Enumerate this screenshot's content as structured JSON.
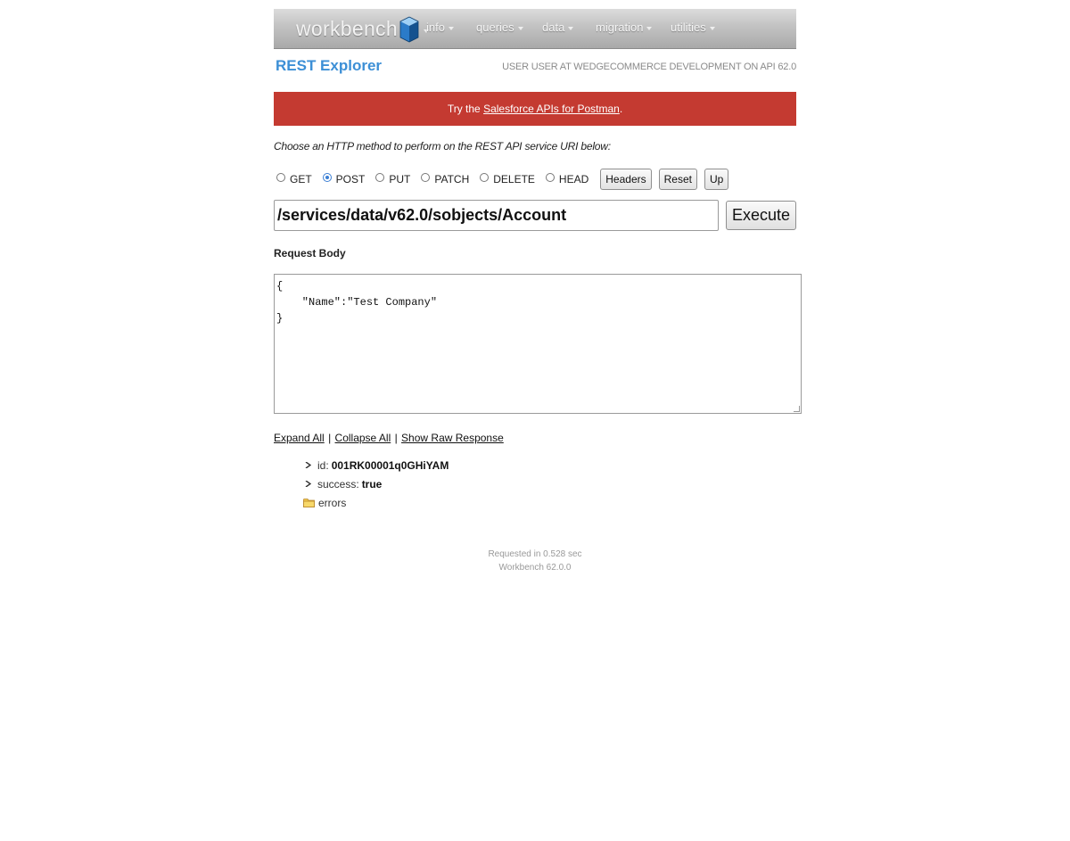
{
  "nav": {
    "logo": "workbench",
    "menu": [
      "info",
      "queries",
      "data",
      "migration",
      "utilities"
    ]
  },
  "header": {
    "title": "REST Explorer",
    "user_info": "USER USER AT WEDGECOMMERCE DEVELOPMENT ON API 62.0"
  },
  "banner": {
    "prefix": "Try the",
    "link": "Salesforce APIs for Postman",
    "suffix": "."
  },
  "form": {
    "instructions": "Choose an HTTP method to perform on the REST API service URI below:",
    "methods": [
      {
        "label": "GET",
        "checked": false
      },
      {
        "label": "POST",
        "checked": true
      },
      {
        "label": "PUT",
        "checked": false
      },
      {
        "label": "PATCH",
        "checked": false
      },
      {
        "label": "DELETE",
        "checked": false
      },
      {
        "label": "HEAD",
        "checked": false
      }
    ],
    "buttons": {
      "headers": "Headers",
      "reset": "Reset",
      "up": "Up"
    },
    "uri": "/services/data/v62.0/sobjects/Account",
    "execute": "Execute",
    "request_body_label": "Request Body",
    "request_body": "{\n    \"Name\":\"Test Company\"\n}"
  },
  "response": {
    "links": {
      "expand": "Expand All",
      "collapse": "Collapse All",
      "raw": "Show Raw Response",
      "separator": "|"
    },
    "tree": [
      {
        "key": "id:",
        "value": "001RK00001q0GHiYAM"
      },
      {
        "key": "success:",
        "value": "true"
      }
    ],
    "folder": "errors"
  },
  "footer": {
    "timing": "Requested in 0.528 sec",
    "version": "Workbench 62.0.0"
  },
  "colors": {
    "accent": "#3c8fd6",
    "banner": "#c43a31"
  }
}
